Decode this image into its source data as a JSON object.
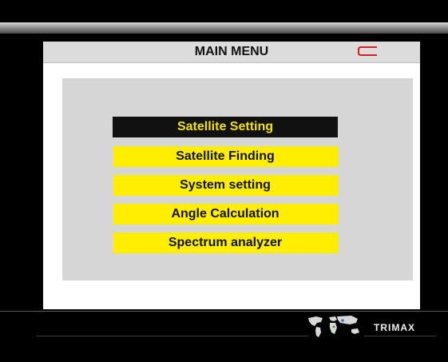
{
  "header": {
    "title": "MAIN MENU",
    "back_icon": "return-arrow-icon",
    "back_icon_color": "#d42020"
  },
  "menu": {
    "selected_index": 0,
    "items": [
      {
        "label": "Satellite Setting"
      },
      {
        "label": "Satellite Finding"
      },
      {
        "label": "System setting"
      },
      {
        "label": "Angle Calculation"
      },
      {
        "label": "Spectrum analyzer"
      }
    ]
  },
  "footer": {
    "brand": "TRIMAX",
    "logo_icon": "world-map-icon"
  },
  "colors": {
    "item_bg": "#ffee00",
    "selected_bg": "#111111",
    "selected_text": "#f5e300",
    "panel_bg": "#d6d6d6"
  }
}
